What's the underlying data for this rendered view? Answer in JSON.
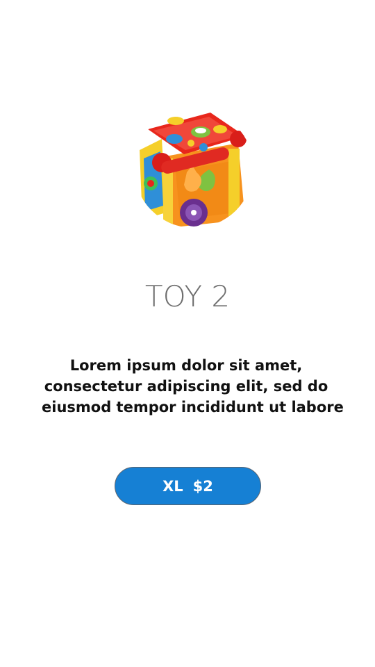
{
  "product": {
    "image": {
      "icon": "toy-activity-cube-icon",
      "colors": {
        "top": "#e8271c",
        "body": "#f7921e",
        "frame": "#f5cf2a",
        "accent_blue": "#2f8fd8",
        "accent_purple": "#6a2f8f"
      }
    },
    "title": "TOY 2",
    "description_lines": [
      "Lorem ipsum dolor sit amet,",
      "consectetur adipiscing elit, sed do",
      "eiusmod tempor incididunt ut labore"
    ],
    "button": {
      "size": "XL",
      "price": "$2",
      "color": "#1680d4"
    }
  }
}
